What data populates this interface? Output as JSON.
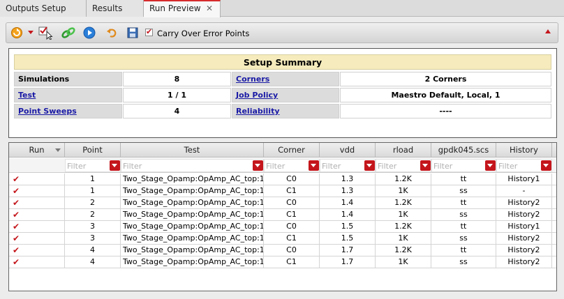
{
  "tabs": [
    {
      "label": "Outputs Setup",
      "active": false
    },
    {
      "label": "Results",
      "active": false
    },
    {
      "label": "Run Preview",
      "active": true,
      "close": "✕"
    }
  ],
  "toolbar": {
    "carry_over_label": "Carry Over Error Points",
    "carry_over_checked": true,
    "icons": [
      "run-options-icon",
      "dropdown-arrow-icon",
      "select-points-icon",
      "link-icon",
      "play-icon",
      "undo-icon",
      "save-icon"
    ]
  },
  "summary": {
    "title": "Setup Summary",
    "rows": [
      {
        "l1": "Simulations",
        "v1": "8",
        "l2": "Corners",
        "v2": "2 Corners"
      },
      {
        "l1": "Test",
        "v1": "1 / 1",
        "l2": "Job Policy",
        "v2": "Maestro Default, Local, 1"
      },
      {
        "l1": "Point Sweeps",
        "v1": "4",
        "l2": "Reliability",
        "v2": "----"
      }
    ]
  },
  "table": {
    "columns": [
      "Run",
      "Point",
      "Test",
      "Corner",
      "vdd",
      "rload",
      "gpdk045.scs",
      "History"
    ],
    "filter_placeholder": "Filter",
    "rows": [
      {
        "point": "1",
        "test": "Two_Stage_Opamp:OpAmp_AC_top:1",
        "corner": "C0",
        "vdd": "1.3",
        "rload": "1.2K",
        "gpdk": "tt",
        "history": "History1"
      },
      {
        "point": "1",
        "test": "Two_Stage_Opamp:OpAmp_AC_top:1",
        "corner": "C1",
        "vdd": "1.3",
        "rload": "1K",
        "gpdk": "ss",
        "history": "-"
      },
      {
        "point": "2",
        "test": "Two_Stage_Opamp:OpAmp_AC_top:1",
        "corner": "C0",
        "vdd": "1.4",
        "rload": "1.2K",
        "gpdk": "tt",
        "history": "History2"
      },
      {
        "point": "2",
        "test": "Two_Stage_Opamp:OpAmp_AC_top:1",
        "corner": "C1",
        "vdd": "1.4",
        "rload": "1K",
        "gpdk": "ss",
        "history": "History2"
      },
      {
        "point": "3",
        "test": "Two_Stage_Opamp:OpAmp_AC_top:1",
        "corner": "C0",
        "vdd": "1.5",
        "rload": "1.2K",
        "gpdk": "tt",
        "history": "History1"
      },
      {
        "point": "3",
        "test": "Two_Stage_Opamp:OpAmp_AC_top:1",
        "corner": "C1",
        "vdd": "1.5",
        "rload": "1K",
        "gpdk": "ss",
        "history": "History2"
      },
      {
        "point": "4",
        "test": "Two_Stage_Opamp:OpAmp_AC_top:1",
        "corner": "C0",
        "vdd": "1.7",
        "rload": "1.2K",
        "gpdk": "tt",
        "history": "History2"
      },
      {
        "point": "4",
        "test": "Two_Stage_Opamp:OpAmp_AC_top:1",
        "corner": "C1",
        "vdd": "1.7",
        "rload": "1K",
        "gpdk": "ss",
        "history": "History2"
      }
    ]
  },
  "colors": {
    "accent": "#c4161c",
    "link": "#1a1aa6",
    "summary_title_bg": "#f5ebbc"
  }
}
